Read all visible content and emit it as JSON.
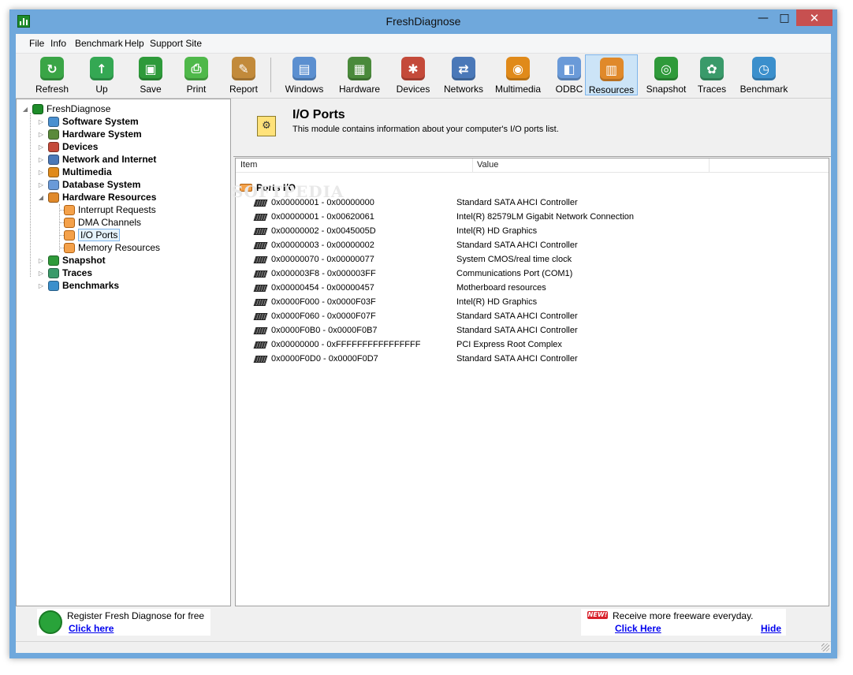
{
  "window": {
    "title": "FreshDiagnose"
  },
  "menu": [
    "File",
    "Info",
    "Benchmark",
    "Help",
    "Support Site"
  ],
  "toolbar": [
    {
      "label": "Refresh",
      "icon": "refresh-icon",
      "color": "#3aa546",
      "glyph": "↻"
    },
    {
      "label": "Up",
      "icon": "up-arrow-icon",
      "color": "#34a853",
      "glyph": "↑"
    },
    {
      "label": "Save",
      "icon": "save-icon",
      "color": "#2e9a3a",
      "glyph": "▣"
    },
    {
      "label": "Print",
      "icon": "print-icon",
      "color": "#4fb84a",
      "glyph": "⎙"
    },
    {
      "label": "Report",
      "icon": "report-icon",
      "color": "#c28a3b",
      "glyph": "✎"
    },
    {
      "label": "Windows",
      "icon": "windows-icon",
      "color": "#5b8fd0",
      "glyph": "▤"
    },
    {
      "label": "Hardware",
      "icon": "hardware-icon",
      "color": "#4a8a3b",
      "glyph": "▦"
    },
    {
      "label": "Devices",
      "icon": "devices-icon",
      "color": "#c44a3a",
      "glyph": "✱"
    },
    {
      "label": "Networks",
      "icon": "networks-icon",
      "color": "#4a78b8",
      "glyph": "⇄"
    },
    {
      "label": "Multimedia",
      "icon": "multimedia-icon",
      "color": "#e08a1a",
      "glyph": "◉"
    },
    {
      "label": "ODBC",
      "icon": "odbc-icon",
      "color": "#6a9ad8",
      "glyph": "◧"
    },
    {
      "label": "Resources",
      "icon": "resources-icon",
      "color": "#e0892a",
      "glyph": "▥"
    },
    {
      "label": "Snapshot",
      "icon": "snapshot-icon",
      "color": "#2f9a3a",
      "glyph": "◎"
    },
    {
      "label": "Traces",
      "icon": "traces-icon",
      "color": "#3a9a6a",
      "glyph": "✿"
    },
    {
      "label": "Benchmark",
      "icon": "benchmark-icon",
      "color": "#3b8fcc",
      "glyph": "◷"
    }
  ],
  "tree": {
    "root": "FreshDiagnose",
    "items": [
      {
        "label": "Software System",
        "icon": "software-system-icon",
        "color": "#4a90d0"
      },
      {
        "label": "Hardware System",
        "icon": "hardware-system-icon",
        "color": "#5a8a3b"
      },
      {
        "label": "Devices",
        "icon": "devices-icon",
        "color": "#c44a3a"
      },
      {
        "label": "Network and Internet",
        "icon": "network-icon",
        "color": "#4a78b8"
      },
      {
        "label": "Multimedia",
        "icon": "multimedia-icon",
        "color": "#e08a1a"
      },
      {
        "label": "Database System",
        "icon": "database-icon",
        "color": "#6a9ad8"
      },
      {
        "label": "Hardware Resources",
        "icon": "hardware-resources-icon",
        "color": "#e0892a"
      }
    ],
    "children": [
      "Interrupt Requests",
      "DMA Channels",
      "I/O Ports",
      "Memory Resources"
    ],
    "after": [
      {
        "label": "Snapshot",
        "icon": "snapshot-icon",
        "color": "#2f9a3a"
      },
      {
        "label": "Traces",
        "icon": "traces-icon",
        "color": "#3a9a6a"
      },
      {
        "label": "Benchmarks",
        "icon": "benchmarks-icon",
        "color": "#3b8fcc"
      }
    ]
  },
  "module": {
    "title": "I/O Ports",
    "description": "This module contains information about your computer's I/O ports list."
  },
  "list": {
    "columns": [
      "Item",
      "Value"
    ],
    "watermark": "SOFTPEDIA",
    "group": "Ports I/O",
    "rows": [
      {
        "item": "0x00000001 - 0x00000000",
        "value": "Standard SATA AHCI Controller"
      },
      {
        "item": "0x00000001 - 0x00620061",
        "value": "Intel(R) 82579LM Gigabit Network Connection"
      },
      {
        "item": "0x00000002 - 0x0045005D",
        "value": "Intel(R) HD Graphics"
      },
      {
        "item": "0x00000003 - 0x00000002",
        "value": "Standard SATA AHCI Controller"
      },
      {
        "item": "0x00000070 - 0x00000077",
        "value": "System CMOS/real time clock"
      },
      {
        "item": "0x000003F8 - 0x000003FF",
        "value": "Communications Port (COM1)"
      },
      {
        "item": "0x00000454 - 0x00000457",
        "value": "Motherboard resources"
      },
      {
        "item": "0x0000F000 - 0x0000F03F",
        "value": "Intel(R) HD Graphics"
      },
      {
        "item": "0x0000F060 - 0x0000F07F",
        "value": "Standard SATA AHCI Controller"
      },
      {
        "item": "0x0000F0B0 - 0x0000F0B7",
        "value": "Standard SATA AHCI Controller"
      },
      {
        "item": "0x00000000 - 0xFFFFFFFFFFFFFFFF",
        "value": "PCI Express Root Complex"
      },
      {
        "item": "0x0000F0D0 - 0x0000F0D7",
        "value": "Standard SATA AHCI Controller"
      }
    ]
  },
  "status": {
    "register_text": "Register Fresh Diagnose for free",
    "register_link": "Click here",
    "new_badge": "NEW!",
    "freeware_text": "Receive more freeware everyday.",
    "freeware_link": "Click Here",
    "hide_link": "Hide"
  }
}
